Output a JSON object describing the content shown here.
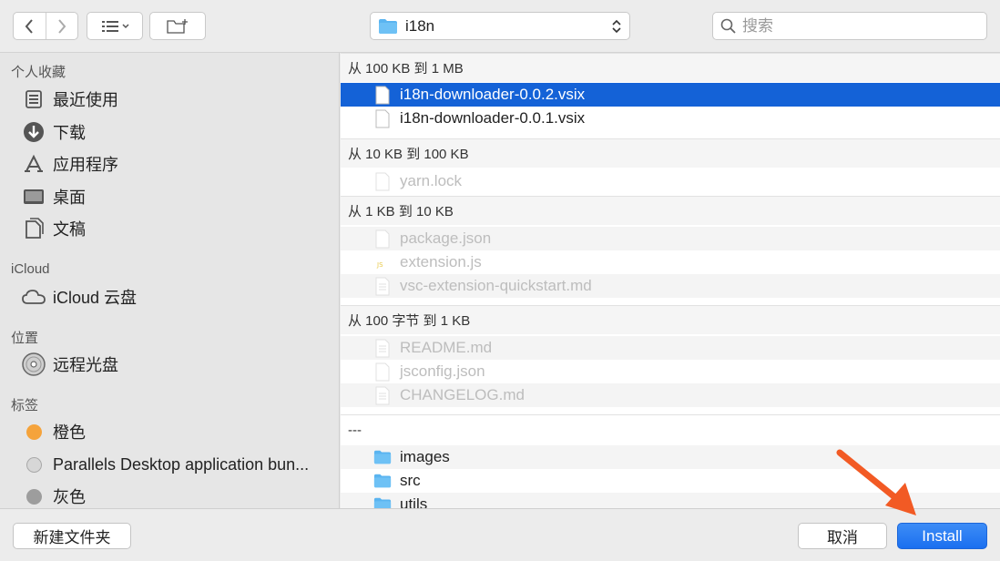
{
  "toolbar": {
    "path_label": "i18n",
    "search_placeholder": "搜索"
  },
  "sidebar": {
    "sections": [
      {
        "title": "个人收藏",
        "items": [
          {
            "label": "最近使用",
            "icon": "recents-icon"
          },
          {
            "label": "下载",
            "icon": "downloads-icon"
          },
          {
            "label": "应用程序",
            "icon": "applications-icon"
          },
          {
            "label": "桌面",
            "icon": "desktop-icon"
          },
          {
            "label": "文稿",
            "icon": "documents-icon"
          }
        ]
      },
      {
        "title": "iCloud",
        "items": [
          {
            "label": "iCloud 云盘",
            "icon": "icloud-icon"
          }
        ]
      },
      {
        "title": "位置",
        "items": [
          {
            "label": "远程光盘",
            "icon": "disc-icon"
          }
        ]
      },
      {
        "title": "标签",
        "items": [
          {
            "label": "橙色",
            "icon": "tag-dot-icon",
            "color": "#f5a33b"
          },
          {
            "label": "Parallels Desktop application bun...",
            "icon": "tag-dot-icon",
            "color": "#d7d7d7"
          },
          {
            "label": "灰色",
            "icon": "tag-dot-icon",
            "color": "#9d9d9d"
          }
        ]
      }
    ]
  },
  "filelist": {
    "groups": [
      {
        "header": "从 100 KB 到 1 MB",
        "files": [
          {
            "name": "i18n-downloader-0.0.2.vsix",
            "selected": true,
            "dim": false,
            "icon": "file-icon"
          },
          {
            "name": "i18n-downloader-0.0.1.vsix",
            "selected": false,
            "dim": false,
            "icon": "file-icon"
          }
        ]
      },
      {
        "header": "从 10 KB 到 100 KB",
        "files": [
          {
            "name": "yarn.lock",
            "selected": false,
            "dim": true,
            "icon": "file-icon"
          }
        ]
      },
      {
        "header": "从 1 KB 到 10 KB",
        "files": [
          {
            "name": "package.json",
            "selected": false,
            "dim": true,
            "icon": "file-icon"
          },
          {
            "name": "extension.js",
            "selected": false,
            "dim": true,
            "icon": "js-file-icon"
          },
          {
            "name": "vsc-extension-quickstart.md",
            "selected": false,
            "dim": true,
            "icon": "text-file-icon"
          }
        ]
      },
      {
        "header": "从 100 字节 到 1 KB",
        "files": [
          {
            "name": "README.md",
            "selected": false,
            "dim": true,
            "icon": "text-file-icon"
          },
          {
            "name": "jsconfig.json",
            "selected": false,
            "dim": true,
            "icon": "file-icon"
          },
          {
            "name": "CHANGELOG.md",
            "selected": false,
            "dim": true,
            "icon": "text-file-icon"
          }
        ]
      },
      {
        "header": "---",
        "files": [
          {
            "name": "images",
            "selected": false,
            "dim": false,
            "icon": "folder-icon"
          },
          {
            "name": "src",
            "selected": false,
            "dim": false,
            "icon": "folder-icon"
          },
          {
            "name": "utils",
            "selected": false,
            "dim": false,
            "icon": "folder-icon"
          }
        ]
      }
    ]
  },
  "bottombar": {
    "new_folder_label": "新建文件夹",
    "cancel_label": "取消",
    "install_label": "Install"
  },
  "colors": {
    "accent": "#1462d7",
    "folder": "#5ab4f0",
    "arrow": "#f25a24"
  }
}
